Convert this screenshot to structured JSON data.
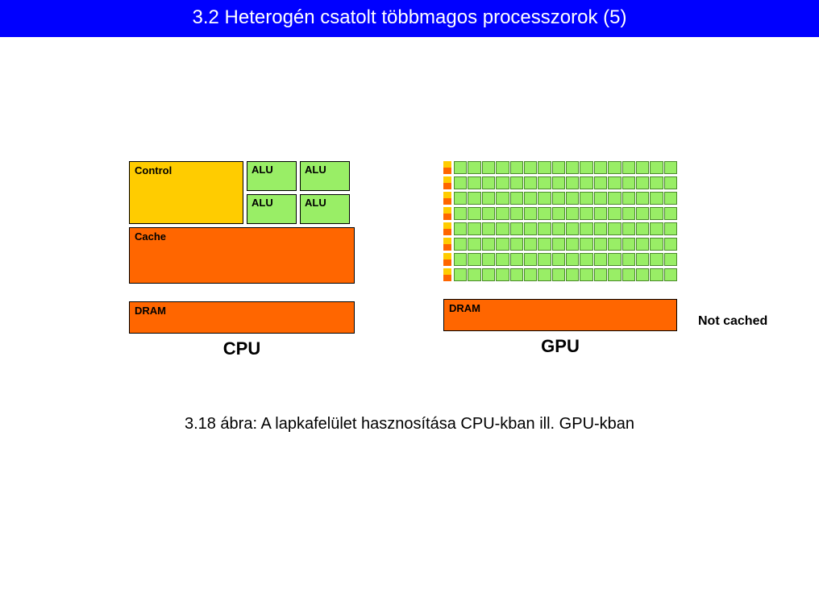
{
  "title": "3.2 Heterogén csatolt többmagos processzorok (5)",
  "cpu": {
    "control": "Control",
    "alu": "ALU",
    "cache": "Cache",
    "dram": "DRAM",
    "label": "CPU"
  },
  "gpu": {
    "rows": 8,
    "alusPerRow": 16,
    "dram": "DRAM",
    "label": "GPU"
  },
  "annotation": "Not cached",
  "caption": "3.18 ábra: A lapkafelület hasznosítása CPU-kban ill. GPU-kban"
}
